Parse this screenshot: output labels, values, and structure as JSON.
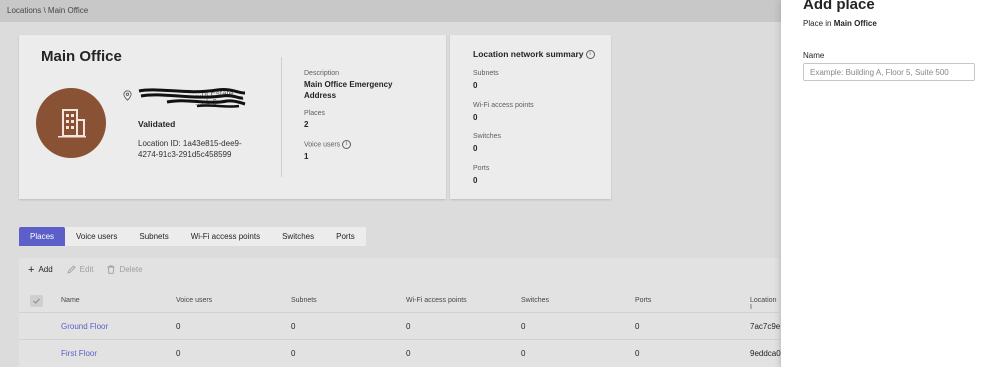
{
  "breadcrumb": "Locations \\ Main Office",
  "location": {
    "title": "Main Office",
    "address_line1": "...nt Estate",
    "address_line2": "...ek 6",
    "validated_label": "Validated",
    "location_id_text": "Location ID: 1a43e815-dee9-4274-91c3-291d5c458599",
    "avatar_icon": "building-icon",
    "avatar_color": "#8a5234",
    "description_label": "Description",
    "description_value": "Main Office Emergency Address",
    "places_label": "Places",
    "places_value": "2",
    "voice_users_label": "Voice users",
    "voice_users_value": "1"
  },
  "summary": {
    "title": "Location network summary",
    "items": [
      {
        "label": "Subnets",
        "value": "0"
      },
      {
        "label": "Wi-Fi access points",
        "value": "0"
      },
      {
        "label": "Switches",
        "value": "0"
      },
      {
        "label": "Ports",
        "value": "0"
      }
    ]
  },
  "tabs": [
    {
      "label": "Places",
      "active": true
    },
    {
      "label": "Voice users",
      "active": false
    },
    {
      "label": "Subnets",
      "active": false
    },
    {
      "label": "Wi-Fi access points",
      "active": false
    },
    {
      "label": "Switches",
      "active": false
    },
    {
      "label": "Ports",
      "active": false
    }
  ],
  "toolbar": {
    "add_label": "Add",
    "edit_label": "Edit",
    "delete_label": "Delete"
  },
  "table": {
    "columns": [
      "Name",
      "Voice users",
      "Subnets",
      "Wi-Fi access points",
      "Switches",
      "Ports",
      "Location I"
    ],
    "rows": [
      [
        "Ground Floor",
        "0",
        "0",
        "0",
        "0",
        "0",
        "7ac7c9e"
      ],
      [
        "First Floor",
        "0",
        "0",
        "0",
        "0",
        "0",
        "9eddca0"
      ]
    ]
  },
  "panel": {
    "title": "Add place",
    "subtitle_prefix": "Place in",
    "subtitle_location": "Main Office",
    "name_label": "Name",
    "name_placeholder": "Example: Building A, Floor 5, Suite 500",
    "name_value": ""
  },
  "colors": {
    "accent": "#5b5fc7",
    "avatar": "#8a5234"
  }
}
